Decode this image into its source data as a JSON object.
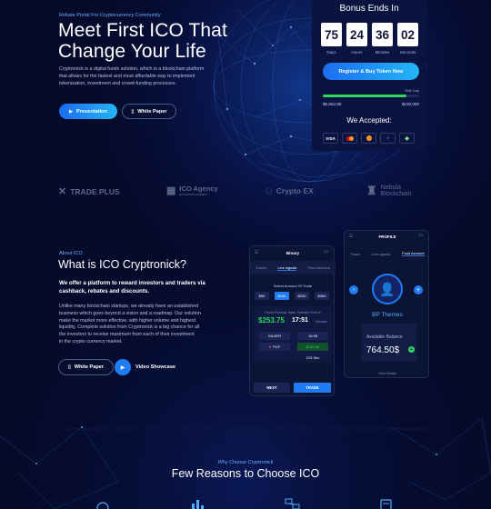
{
  "hero": {
    "subtitle": "Rebate Portal For Cryptocurrency Community",
    "title_line1": "Meet First ICO That",
    "title_line2": "Change Your Life",
    "description_line1": "Cryptronick is a digital funds solution, which is a blockchain platform",
    "description_line2": "that allows for the fastest and most affordable way to implement",
    "description_line3": "tokenization, investment and crowd-funding processes.",
    "btn_presentation": "Presentation",
    "btn_white_paper": "White Paper"
  },
  "countdown": {
    "title": "Bonus Ends In",
    "days": "75",
    "hours": "24",
    "minutes": "36",
    "seconds": "02",
    "days_label": "Days",
    "hours_label": "Hours",
    "minutes_label": "Minutes",
    "seconds_label": "Seconds",
    "cta_button": "Register & Buy Token Now",
    "soft_cap_label": "Soft Cap",
    "raised": "$5,552.80",
    "target": "$100,000",
    "progress_pct": 87,
    "accepted_title": "We Accepted:",
    "payments": [
      "VISA",
      "MC",
      "BTC",
      "XRP",
      "ETH"
    ]
  },
  "partners": [
    {
      "name": "TRADE PLUS",
      "icon": "trade-plus-logo-icon"
    },
    {
      "name": "ICO Agency",
      "sub": "BY CRYPTO AGENCY",
      "icon": "ico-agency-logo-icon"
    },
    {
      "name": "Crypto EX",
      "icon": "crypto-ex-logo-icon"
    },
    {
      "name": "Nebula",
      "sub": "Blockchain",
      "icon": "nebula-logo-icon"
    }
  ],
  "about": {
    "eyebrow": "About ICO",
    "title": "What is ICO Cryptronick?",
    "lead_line1": "We offer a platform to reward investors and traders via",
    "lead_line2": "cashback, rebates and discounts.",
    "body_line1": "Unlike many blockchain startups, we already have an established",
    "body_line2": "business which goes beyond a vision and a roadmap. Our solution",
    "body_line3": "make the market more effective, with higher volume and highest",
    "body_line4": "liquidity. Complete solution from Cryptronick is a big chance for all",
    "body_line5": "the investors to receive maximum from each of their investment",
    "body_line6": "in the crypto currency market.",
    "btn_white_paper": "White Paper",
    "btn_video": "Video Showcase"
  },
  "phone_binary": {
    "title": "Binary",
    "tab1": "Trades",
    "tab2": "Live signals",
    "tab3": "Fund Account",
    "select_label": "Select Amount Of Trade",
    "amounts": [
      "$50",
      "$100",
      "$200",
      "$300"
    ],
    "found_label": "Found Potential Trade, Potential Profit of",
    "profit": "$253.75",
    "timer": "17:51",
    "timer_unit": "Minutes",
    "silver": "SILVER",
    "put": "PUT",
    "v1": "15.98",
    "v2": "$120.98",
    "v3": "215 Sec",
    "next": "NEXT",
    "trade": "TRADE"
  },
  "phone_profile": {
    "title": "PROFILE",
    "tab1": "Trade",
    "tab2": "Live signals",
    "tab3": "Fund Account",
    "name": "BP Themes",
    "balance_label": "Available Balance",
    "balance": "764.50$",
    "footer": "View Details"
  },
  "reasons": {
    "eyebrow": "Why Choose Cryptronick",
    "title": "Few Reasons to Choose ICO"
  },
  "colors": {
    "accent": "#1f7cf2",
    "green": "#2fd65b",
    "bg": "#060b2c"
  }
}
